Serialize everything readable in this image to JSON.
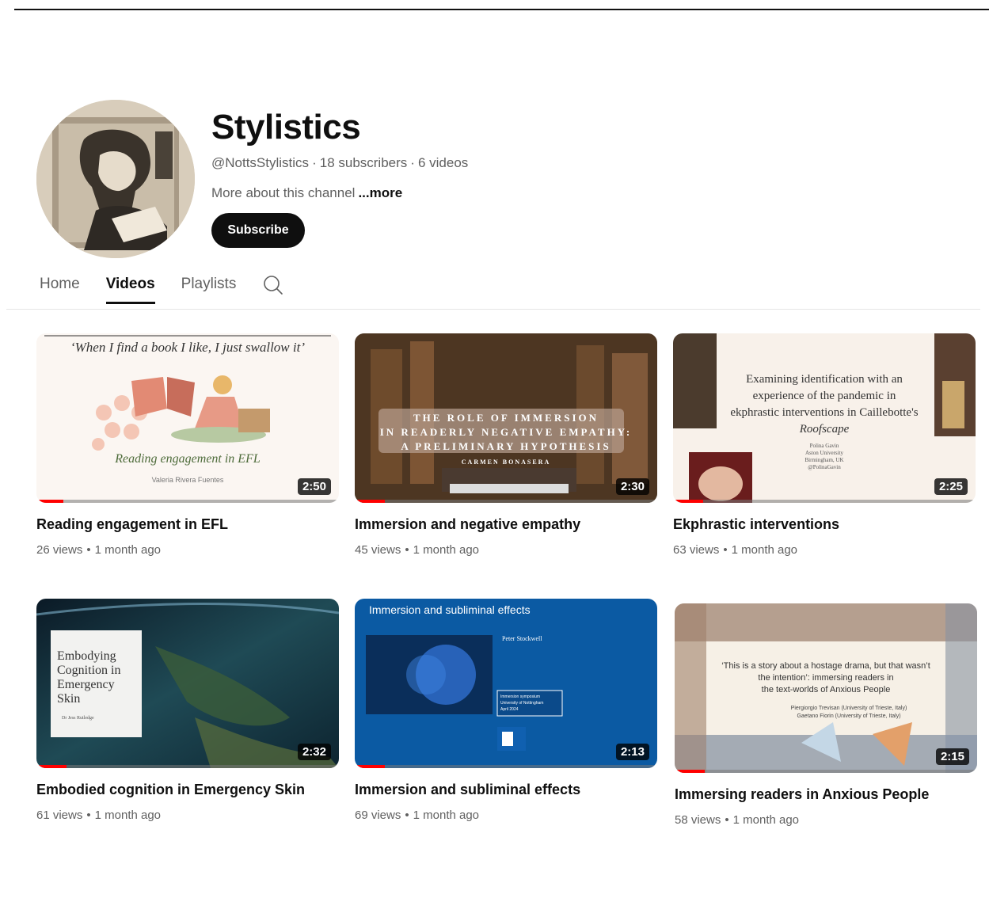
{
  "channel": {
    "name": "Stylistics",
    "handle": "@NottsStylistics",
    "subscribers": "18 subscribers",
    "videos_count": "6 videos",
    "about": "More about this channel",
    "more_label": "...more",
    "subscribe_label": "Subscribe"
  },
  "tabs": [
    {
      "label": "Home",
      "active": false
    },
    {
      "label": "Videos",
      "active": true
    },
    {
      "label": "Playlists",
      "active": false
    }
  ],
  "videos": [
    {
      "title": "Reading engagement in EFL",
      "views": "26 views",
      "age": "1 month ago",
      "duration": "2:50",
      "watched": 0.09,
      "thumb": {
        "quote": "‘When I find a book I like, I just swallow it’",
        "subtitle": "Reading engagement in EFL",
        "author": "Valeria Rivera Fuentes"
      }
    },
    {
      "title": "Immersion and negative empathy",
      "views": "45 views",
      "age": "1 month ago",
      "duration": "2:30",
      "watched": 0.1,
      "thumb": {
        "line1": "THE ROLE OF IMMERSION",
        "line2": "IN READERLY NEGATIVE EMPATHY:",
        "line3": "A PRELIMINARY HYPOTHESIS",
        "author": "CARMEN BONASERA"
      }
    },
    {
      "title": "Ekphrastic interventions",
      "views": "63 views",
      "age": "1 month ago",
      "duration": "2:25",
      "watched": 0.1,
      "thumb": {
        "line1": "Examining identification with an",
        "line2": "experience of the pandemic in",
        "line3": "ekphrastic interventions in Caillebotte's",
        "line4": "Roofscape",
        "author": "Polina Gavin",
        "affil1": "Aston University",
        "affil2": "Birmingham, UK",
        "social": "@PolinaGavin"
      }
    },
    {
      "title": "Embodied cognition in Emergency Skin",
      "views": "61 views",
      "age": "1 month ago",
      "duration": "2:32",
      "watched": 0.1,
      "thumb": {
        "line1": "Embodying",
        "line2": "Cognition in",
        "line3": "Emergency",
        "line4": "Skin",
        "author": "Dr Jess Rutledge"
      }
    },
    {
      "title": "Immersion and subliminal effects",
      "views": "69 views",
      "age": "1 month ago",
      "duration": "2:13",
      "watched": 0.1,
      "thumb": {
        "heading": "Immersion and  subliminal effects",
        "author": "Peter Stockwell",
        "box1": "Immersion symposium",
        "box2": "University of Nottingham",
        "box3": "April 2024"
      }
    },
    {
      "title": "Immersing readers in Anxious People",
      "views": "58 views",
      "age": "1 month ago",
      "duration": "2:15",
      "watched": 0.1,
      "thumb": {
        "line1": "‘This is a story about a hostage drama, but that wasn’t",
        "line2": "the intention’: immersing readers in",
        "line3": "the text-worlds of Anxious People",
        "author1": "Piergiorgio Trevisan (University of Trieste, Italy)",
        "author2": "Gaetano Fiorin (University of Trieste, Italy)"
      }
    }
  ],
  "colors": {
    "text": "#0f0f0f",
    "muted": "#606060",
    "progress": "#ff0000"
  }
}
